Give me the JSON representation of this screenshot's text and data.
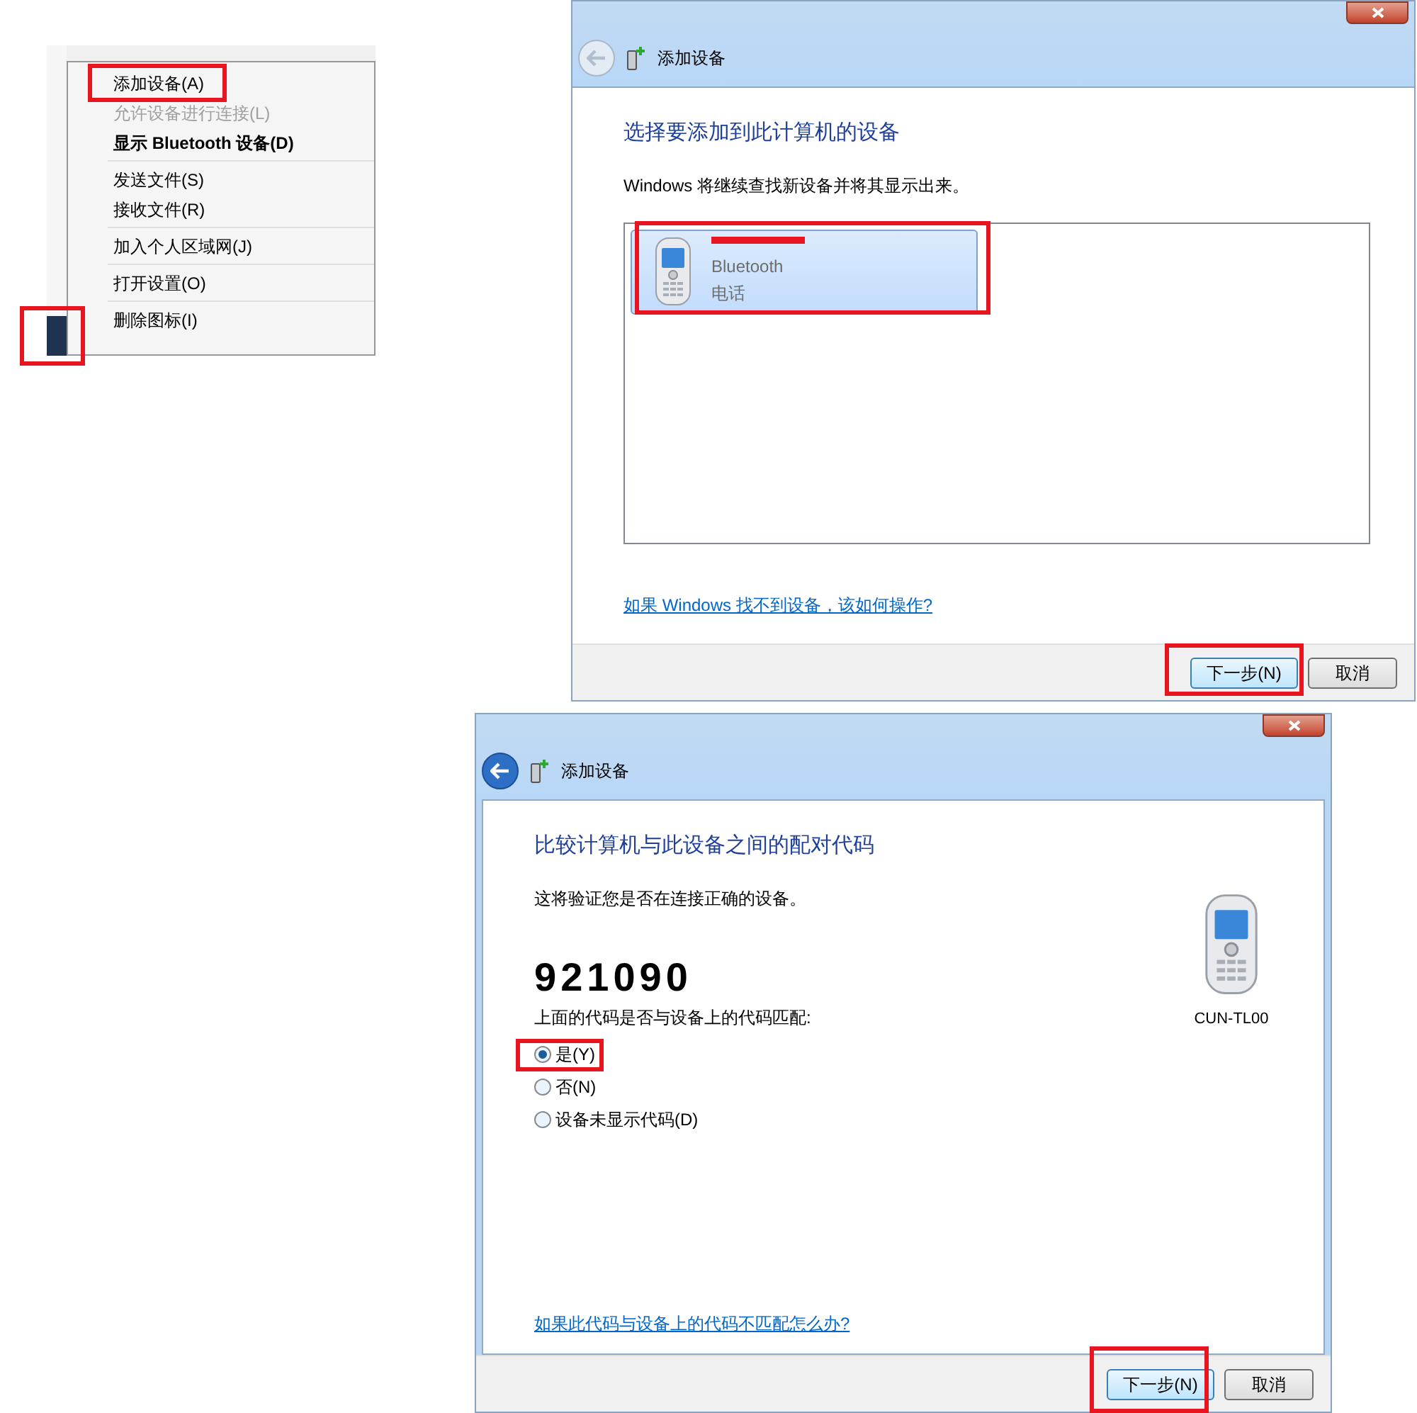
{
  "context_menu": {
    "groups": [
      [
        {
          "label": "添加设备(A)",
          "disabled": false,
          "bold": false
        },
        {
          "label": "允许设备进行连接(L)",
          "disabled": true,
          "bold": false
        },
        {
          "label": "显示 Bluetooth 设备(D)",
          "disabled": false,
          "bold": true
        }
      ],
      [
        {
          "label": "发送文件(S)",
          "disabled": false,
          "bold": false
        },
        {
          "label": "接收文件(R)",
          "disabled": false,
          "bold": false
        }
      ],
      [
        {
          "label": "加入个人区域网(J)",
          "disabled": false,
          "bold": false
        }
      ],
      [
        {
          "label": "打开设置(O)",
          "disabled": false,
          "bold": false
        }
      ],
      [
        {
          "label": "删除图标(I)",
          "disabled": false,
          "bold": false
        }
      ]
    ]
  },
  "add_device_dialog": {
    "title": "添加设备",
    "back_enabled": false,
    "heading": "选择要添加到此计算机的设备",
    "description": "Windows 将继续查找新设备并将其显示出来。",
    "devices": [
      {
        "connection": "Bluetooth",
        "category": "电话",
        "selected": true
      }
    ],
    "help_link": "如果 Windows 找不到设备，该如何操作?",
    "buttons": [
      {
        "label": "下一步(N)",
        "default": true
      },
      {
        "label": "取消",
        "default": false
      }
    ]
  },
  "pairing_dialog": {
    "title": "添加设备",
    "back_enabled": true,
    "heading": "比较计算机与此设备之间的配对代码",
    "description": "这将验证您是否在连接正确的设备。",
    "code": "921090",
    "question": "上面的代码是否与设备上的代码匹配:",
    "options": [
      {
        "label": "是(Y)",
        "selected": true
      },
      {
        "label": "否(N)",
        "selected": false
      },
      {
        "label": "设备未显示代码(D)",
        "selected": false
      }
    ],
    "device_name": "CUN-TL00",
    "help_link": "如果此代码与设备上的代码不匹配怎么办?",
    "buttons": [
      {
        "label": "下一步(N)",
        "default": true
      },
      {
        "label": "取消",
        "default": false
      }
    ]
  }
}
